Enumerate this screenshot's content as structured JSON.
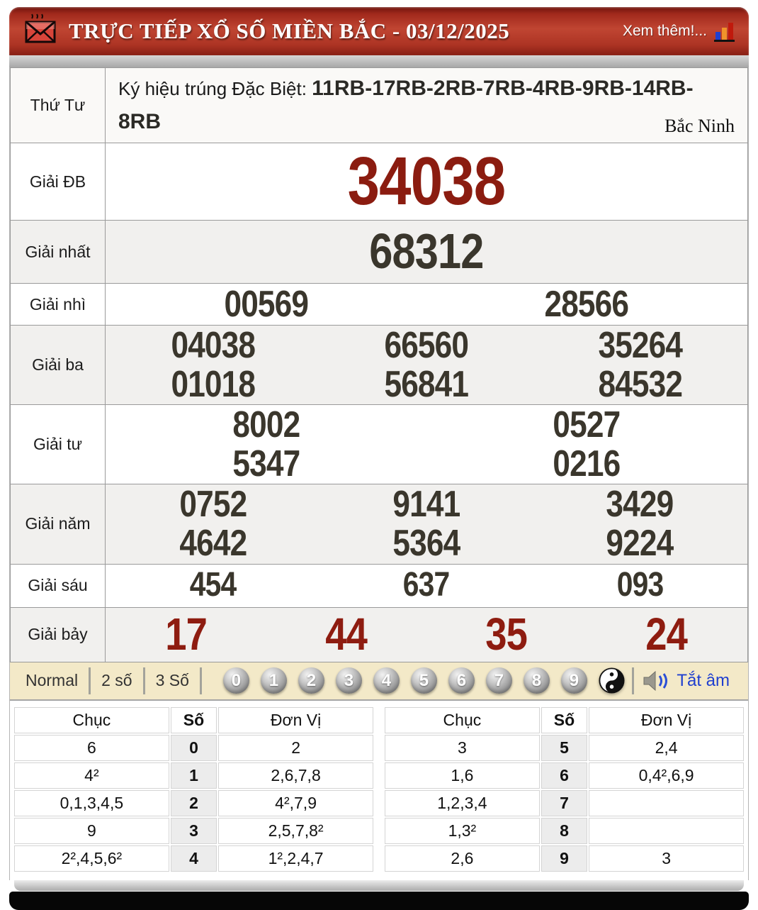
{
  "header": {
    "title": "TRỰC TIẾP XỔ SỐ MIỀN BẮC - 03/12/2025",
    "more_label": "Xem thêm!..."
  },
  "draw": {
    "day": "Thứ Tư",
    "sign_label": "Ký hiệu trúng Đặc Biệt:",
    "sign_codes": "11RB-17RB-2RB-7RB-4RB-9RB-14RB-8RB",
    "province": "Bắc Ninh"
  },
  "prizes": {
    "special_label": "Giải ĐB",
    "special": "34038",
    "first_label": "Giải nhất",
    "first": "68312",
    "second_label": "Giải nhì",
    "second": [
      "00569",
      "28566"
    ],
    "third_label": "Giải ba",
    "third": [
      [
        "04038",
        "66560",
        "35264"
      ],
      [
        "01018",
        "56841",
        "84532"
      ]
    ],
    "fourth_label": "Giải tư",
    "fourth": [
      [
        "8002",
        "0527"
      ],
      [
        "5347",
        "0216"
      ]
    ],
    "fifth_label": "Giải năm",
    "fifth": [
      [
        "0752",
        "9141",
        "3429"
      ],
      [
        "4642",
        "5364",
        "9224"
      ]
    ],
    "sixth_label": "Giải sáu",
    "sixth": [
      "454",
      "637",
      "093"
    ],
    "seventh_label": "Giải bảy",
    "seventh": [
      "17",
      "44",
      "35",
      "24"
    ]
  },
  "controls": {
    "modes": [
      "Normal",
      "2 số",
      "3 Số"
    ],
    "balls": [
      "0",
      "1",
      "2",
      "3",
      "4",
      "5",
      "6",
      "7",
      "8",
      "9"
    ],
    "mute_label": "Tắt âm"
  },
  "stats": {
    "headers": [
      "Chục",
      "Số",
      "Đơn Vị"
    ],
    "left": [
      [
        "6",
        "0",
        "2"
      ],
      [
        "4²",
        "1",
        "2,6,7,8"
      ],
      [
        "0,1,3,4,5",
        "2",
        "4²,7,9"
      ],
      [
        "9",
        "3",
        "2,5,7,8²"
      ],
      [
        "2²,4,5,6²",
        "4",
        "1²,2,4,7"
      ]
    ],
    "right": [
      [
        "3",
        "5",
        "2,4"
      ],
      [
        "1,6",
        "6",
        "0,4²,6,9"
      ],
      [
        "1,2,3,4",
        "7",
        ""
      ],
      [
        "1,3²",
        "8",
        ""
      ],
      [
        "2,6",
        "9",
        "3"
      ]
    ]
  },
  "colors": {
    "accent_red": "#8b1c10",
    "header_red": "#b63a28",
    "control_bg": "#f3e9c8",
    "link_blue": "#1f3fd0"
  }
}
